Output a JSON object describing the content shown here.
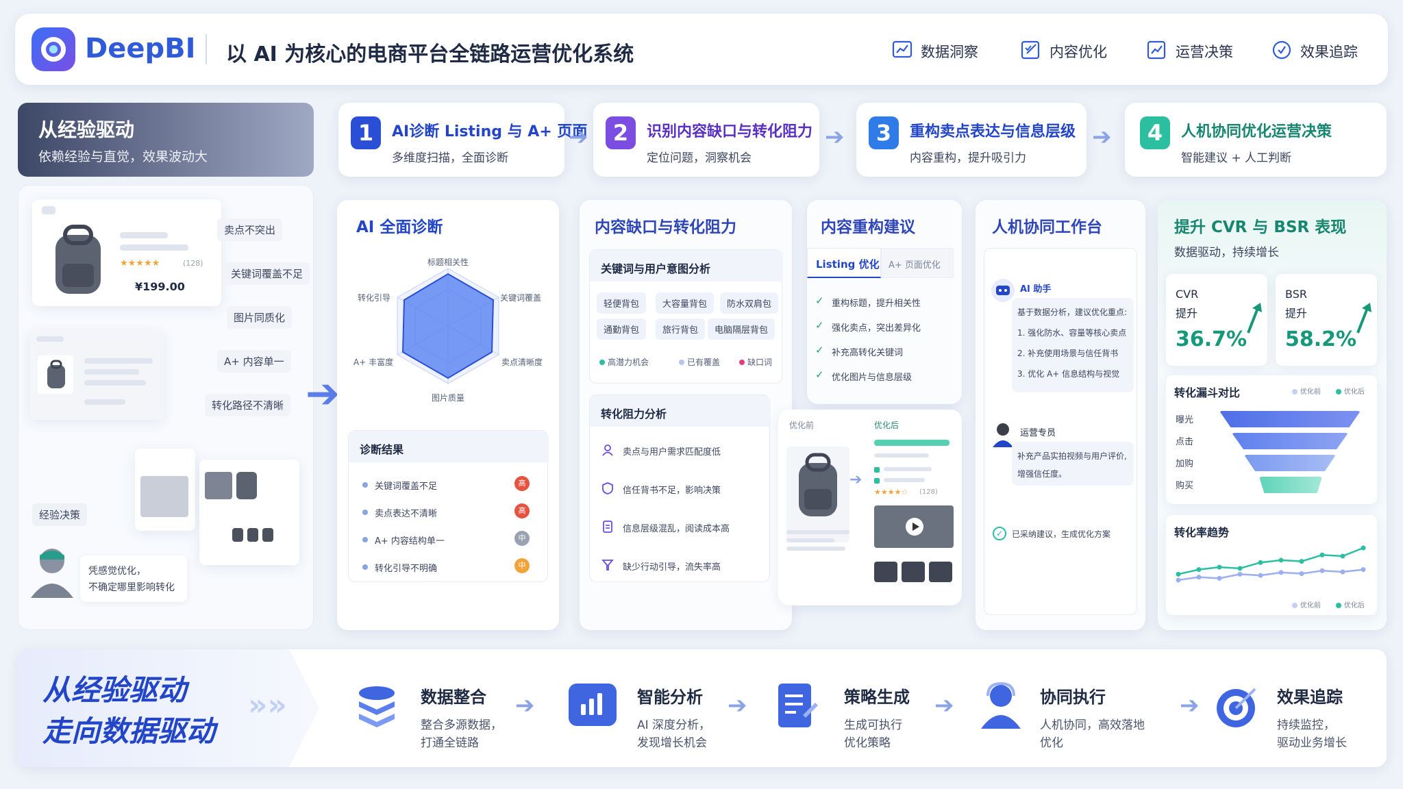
{
  "header": {
    "brand": "DeepBI",
    "title": "以 AI 为核心的电商平台全链路运营优化系统",
    "nav": [
      {
        "label": "数据洞察",
        "icon": "chart-icon"
      },
      {
        "label": "内容优化",
        "icon": "edit-icon"
      },
      {
        "label": "运营决策",
        "icon": "decision-icon"
      },
      {
        "label": "效果追踪",
        "icon": "target-icon"
      }
    ]
  },
  "left": {
    "title": "从经验驱动",
    "subtitle": "依赖经验与直觉，效果波动大",
    "product": {
      "rating": "★★★★★",
      "reviews": "(128)",
      "price": "¥199.00"
    },
    "issues": [
      "卖点不突出",
      "关键词覆盖不足",
      "图片同质化",
      "A+ 内容单一",
      "转化路径不清晰"
    ],
    "decision_label": "经验决策",
    "person_quote_1": "凭感觉优化，",
    "person_quote_2": "不确定哪里影响转化"
  },
  "steps": [
    {
      "num": "1",
      "title": "AI诊断 Listing 与 A+ 页面",
      "desc": "多维度扫描，全面诊断",
      "color": "#2a4fd6"
    },
    {
      "num": "2",
      "title": "识别内容缺口与转化阻力",
      "desc": "定位问题，洞察机会",
      "color": "#7b4de0"
    },
    {
      "num": "3",
      "title": "重构卖点表达与信息层级",
      "desc": "内容重构，提升吸引力",
      "color": "#2f7be8"
    },
    {
      "num": "4",
      "title": "人机协同优化运营决策",
      "desc": "智能建议 + 人工判断",
      "color": "#2bbfa0"
    }
  ],
  "diagnosis": {
    "title": "AI 全面诊断",
    "radar_labels": [
      "标题相关性",
      "关键词覆盖",
      "卖点清晰度",
      "图片质量",
      "A+ 丰富度",
      "转化引导"
    ],
    "results_title": "诊断结果",
    "results": [
      {
        "text": "关键词覆盖不足",
        "level": "高",
        "color": "#e8533f"
      },
      {
        "text": "卖点表达不清晰",
        "level": "高",
        "color": "#e8533f"
      },
      {
        "text": "A+ 内容结构单一",
        "level": "中",
        "color": "#9aa2b1"
      },
      {
        "text": "转化引导不明确",
        "level": "中",
        "color": "#f2a33a"
      }
    ]
  },
  "gaps": {
    "title": "内容缺口与转化阻力",
    "keyword_title": "关键词与用户意图分析",
    "keywords": [
      "轻便背包",
      "大容量背包",
      "防水双肩包",
      "通勤背包",
      "旅行背包",
      "电脑隔层背包"
    ],
    "legend": [
      "高潜力机会",
      "已有覆盖",
      "缺口词"
    ],
    "resistance_title": "转化阻力分析",
    "resistance": [
      "卖点与用户需求匹配度低",
      "信任背书不足，影响决策",
      "信息层级混乱，阅读成本高",
      "缺少行动引导，流失率高"
    ]
  },
  "rebuild": {
    "title": "内容重构建议",
    "tabs": [
      "Listing 优化",
      "A+ 页面优化"
    ],
    "items": [
      "重构标题，提升相关性",
      "强化卖点，突出差异化",
      "补充高转化关键词",
      "优化图片与信息层级"
    ],
    "before": "优化前",
    "after": "优化后",
    "stars": "★★★★☆",
    "reviews": "(128)"
  },
  "collab": {
    "title": "人机协同工作台",
    "ai_name": "AI 助手",
    "ai_lines": [
      "基于数据分析，建议优化重点:",
      "1. 强化防水、容量等核心卖点",
      "2. 补充使用场景与信任背书",
      "3. 优化 A+ 信息结构与视觉"
    ],
    "ops_name": "运营专员",
    "ops_lines": [
      "补充产品实拍视频与用户评价,",
      "增强信任度。"
    ],
    "adopted": "已采纳建议，生成优化方案"
  },
  "results": {
    "title": "提升 CVR 与 BSR 表现",
    "subtitle": "数据驱动，持续增长",
    "kpis": [
      {
        "name": "CVR",
        "label": "提升",
        "value": "36.7%"
      },
      {
        "name": "BSR",
        "label": "提升",
        "value": "58.2%"
      }
    ],
    "funnel_title": "转化漏斗对比",
    "funnel_legend": [
      "优化前",
      "优化后"
    ],
    "funnel_stages": [
      "曝光",
      "点击",
      "加购",
      "购买"
    ],
    "trend_title": "转化率趋势",
    "trend_legend": [
      "优化前",
      "优化后"
    ]
  },
  "chart_data": {
    "type": "line",
    "title": "转化率趋势",
    "series": [
      {
        "name": "优化前",
        "values": [
          2,
          2.5,
          2.3,
          3,
          2.8,
          3.3,
          3.1,
          3.6,
          3.4,
          3.8
        ]
      },
      {
        "name": "优化后",
        "values": [
          3,
          3.8,
          4.2,
          4,
          5,
          5.4,
          5.2,
          6.3,
          6.1,
          7.5
        ]
      }
    ]
  },
  "bottom": {
    "title1": "从经验驱动",
    "title2": "走向数据驱动",
    "steps": [
      {
        "title": "数据整合",
        "desc1": "整合多源数据，",
        "desc2": "打通全链路"
      },
      {
        "title": "智能分析",
        "desc1": "AI 深度分析，",
        "desc2": "发现增长机会"
      },
      {
        "title": "策略生成",
        "desc1": "生成可执行",
        "desc2": "优化策略"
      },
      {
        "title": "协同执行",
        "desc1": "人机协同，高效落地",
        "desc2": "优化"
      },
      {
        "title": "效果追踪",
        "desc1": "持续监控，",
        "desc2": "驱动业务增长"
      }
    ]
  },
  "colors": {
    "primary": "#2346c8",
    "accent": "#2bbfa0",
    "danger": "#e8533f",
    "warning": "#f2a33a"
  }
}
